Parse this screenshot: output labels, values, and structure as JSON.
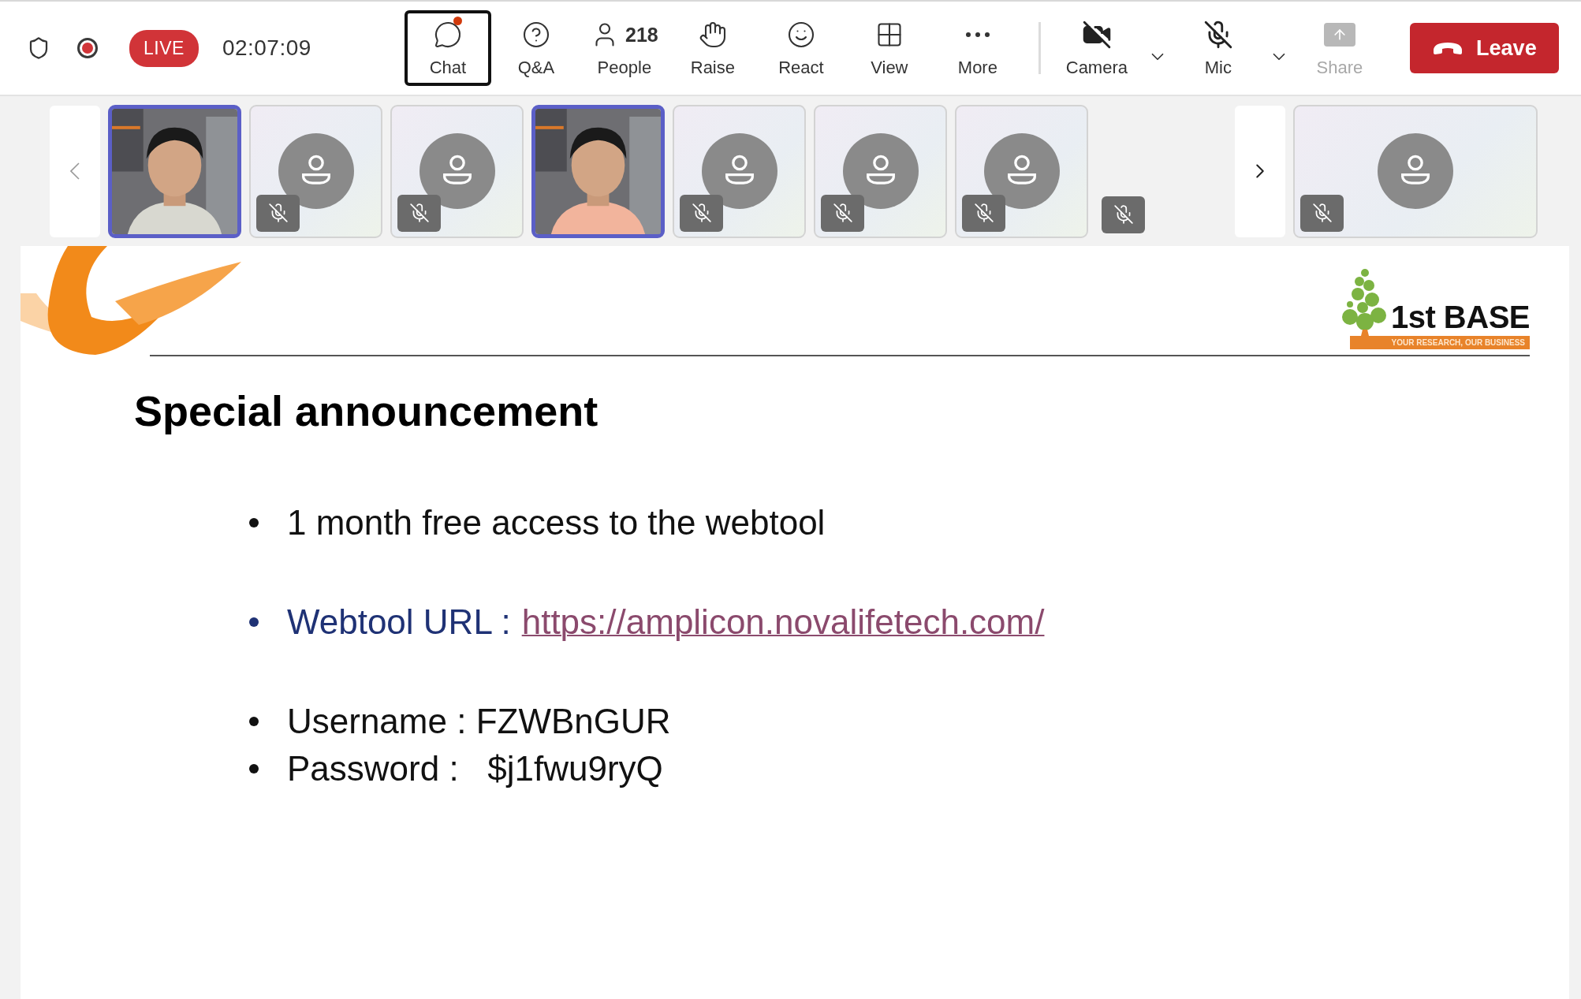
{
  "meeting": {
    "recording": true,
    "live_badge": "LIVE",
    "elapsed": "02:07:09"
  },
  "toolbar": [
    {
      "kind": "chat",
      "label": "Chat",
      "selected": true,
      "unread": true
    },
    {
      "kind": "qa",
      "label": "Q&A",
      "selected": false,
      "unread": false
    },
    {
      "kind": "people",
      "label": "People",
      "count": "218",
      "selected": false,
      "unread": false
    },
    {
      "kind": "raise",
      "label": "Raise",
      "selected": false,
      "unread": false
    },
    {
      "kind": "react",
      "label": "React",
      "selected": false,
      "unread": false
    },
    {
      "kind": "view",
      "label": "View",
      "selected": false,
      "unread": false
    },
    {
      "kind": "more",
      "label": "More",
      "selected": false,
      "unread": false
    }
  ],
  "devices": [
    {
      "kind": "camera",
      "label": "Camera",
      "on": false
    },
    {
      "kind": "mic",
      "label": "Mic",
      "on": false
    }
  ],
  "share": {
    "label": "Share",
    "disabled": true
  },
  "leave": {
    "label": "Leave"
  },
  "participants": [
    {
      "kind": "video",
      "speaking": true,
      "muted": false
    },
    {
      "kind": "avatar",
      "speaking": false,
      "muted": true
    },
    {
      "kind": "avatar",
      "speaking": false,
      "muted": true
    },
    {
      "kind": "video",
      "speaking": true,
      "muted": false
    },
    {
      "kind": "avatar",
      "speaking": false,
      "muted": true
    },
    {
      "kind": "avatar",
      "speaking": false,
      "muted": true
    },
    {
      "kind": "avatar",
      "speaking": false,
      "muted": true
    },
    {
      "kind": "empty",
      "speaking": false,
      "muted": true
    }
  ],
  "pinned": {
    "kind": "avatar",
    "speaking": false,
    "muted": true
  },
  "slide": {
    "logo": {
      "name": "1st BASE",
      "tagline": "YOUR RESEARCH, OUR BUSINESS"
    },
    "title": "Special announcement",
    "groups": [
      [
        {
          "kind": "text",
          "text": "1 month free access to the webtool"
        }
      ],
      [
        {
          "kind": "link",
          "label": "Webtool URL :",
          "url": "https://amplicon.novalifetech.com/"
        }
      ],
      [
        {
          "kind": "text",
          "text": "Username : FZWBnGUR"
        },
        {
          "kind": "text",
          "text": "Password :   $j1fwu9ryQ"
        }
      ]
    ]
  }
}
